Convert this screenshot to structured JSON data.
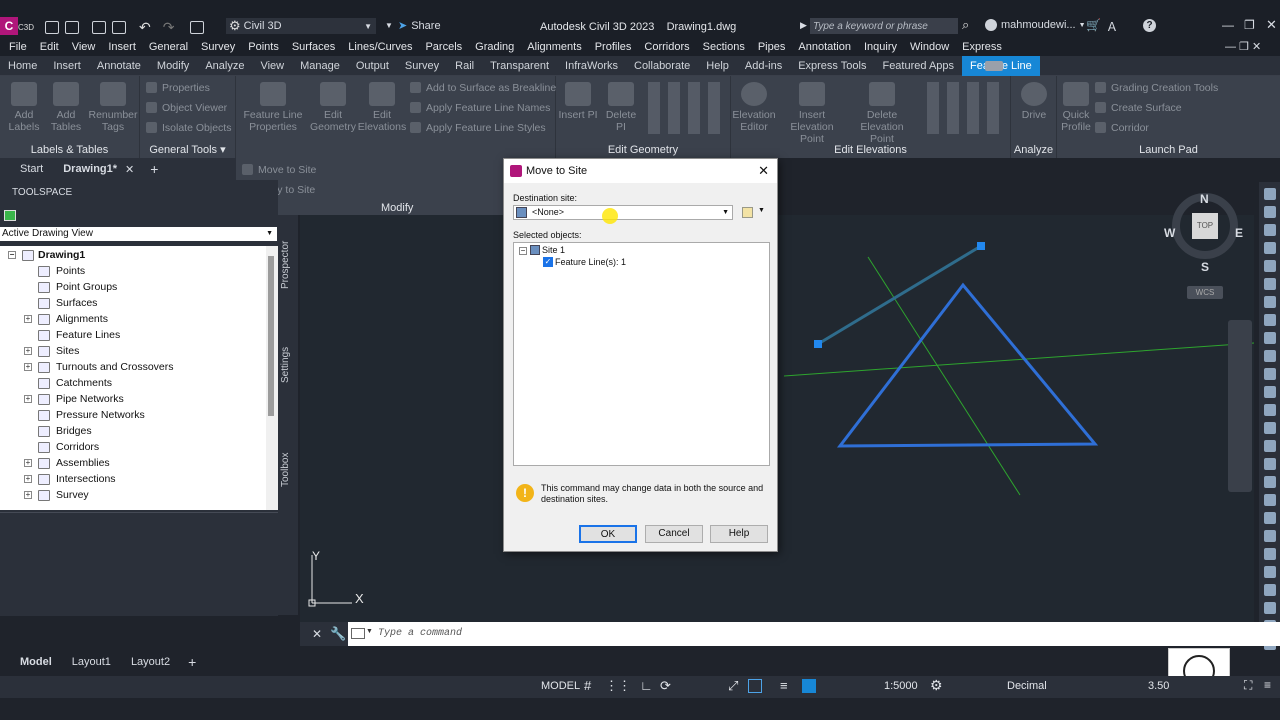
{
  "titlebar": {
    "app_logo": "C",
    "app_sub": "C3D",
    "workspace": "Civil 3D",
    "share": "Share",
    "title": "Autodesk Civil 3D 2023    Drawing1.dwg",
    "search_placeholder": "Type a keyword or phrase",
    "user": "mahmoudewi..."
  },
  "menubar": [
    "File",
    "Edit",
    "View",
    "Insert",
    "General",
    "Survey",
    "Points",
    "Surfaces",
    "Lines/Curves",
    "Parcels",
    "Grading",
    "Alignments",
    "Profiles",
    "Corridors",
    "Sections",
    "Pipes",
    "Annotation",
    "Inquiry",
    "Window",
    "Express"
  ],
  "ribbon_tabs": [
    "Home",
    "Insert",
    "Annotate",
    "Modify",
    "Analyze",
    "View",
    "Manage",
    "Output",
    "Survey",
    "Rail",
    "Transparent",
    "InfraWorks",
    "Collaborate",
    "Help",
    "Add-ins",
    "Express Tools",
    "Featured Apps",
    "Feature Line"
  ],
  "active_tab": "Feature Line",
  "ribbon": {
    "labels_tables": {
      "title": "Labels & Tables",
      "add_labels": "Add Labels",
      "add_tables": "Add Tables",
      "renumber_tags": "Renumber Tags"
    },
    "general_tools": {
      "title": "General Tools",
      "properties": "Properties",
      "object_viewer": "Object Viewer",
      "isolate_objects": "Isolate Objects"
    },
    "modify": {
      "title": "Modify",
      "fl_properties": "Feature Line Properties",
      "edit_geometry": "Edit Geometry",
      "edit_elevations": "Edit Elevations",
      "add_surface": "Add to Surface as Breakline",
      "apply_names": "Apply Feature Line Names",
      "apply_styles": "Apply Feature Line Styles",
      "move_to_site": "Move to Site",
      "copy_to_site": "Copy to Site"
    },
    "edit_geometry": {
      "title": "Edit Geometry",
      "insert_pi": "Insert PI",
      "delete_pi": "Delete PI"
    },
    "edit_elevations": {
      "title": "Edit Elevations",
      "elevation_editor": "Elevation Editor",
      "insert_elev_point": "Insert Elevation Point",
      "delete_elev_point": "Delete Elevation Point"
    },
    "analyze": {
      "title": "Analyze",
      "drive": "Drive"
    },
    "launch_pad": {
      "title": "Launch Pad",
      "quick_profile": "Quick Profile",
      "grading_tools": "Grading Creation Tools",
      "create_surface": "Create Surface",
      "corridor": "Corridor"
    }
  },
  "doc_tabs": {
    "start": "Start",
    "drawing": "Drawing1*"
  },
  "toolspace": {
    "title": "TOOLSPACE",
    "view": "Active Drawing View",
    "root": "Drawing1",
    "items": [
      {
        "label": "Points",
        "exp": ""
      },
      {
        "label": "Point Groups",
        "exp": ""
      },
      {
        "label": "Surfaces",
        "exp": ""
      },
      {
        "label": "Alignments",
        "exp": "+"
      },
      {
        "label": "Feature Lines",
        "exp": ""
      },
      {
        "label": "Sites",
        "exp": "+"
      },
      {
        "label": "Turnouts and Crossovers",
        "exp": "+"
      },
      {
        "label": "Catchments",
        "exp": ""
      },
      {
        "label": "Pipe Networks",
        "exp": "+"
      },
      {
        "label": "Pressure Networks",
        "exp": ""
      },
      {
        "label": "Bridges",
        "exp": ""
      },
      {
        "label": "Corridors",
        "exp": ""
      },
      {
        "label": "Assemblies",
        "exp": "+"
      },
      {
        "label": "Intersections",
        "exp": "+"
      },
      {
        "label": "Survey",
        "exp": "+"
      }
    ],
    "side_tabs": [
      "Prospector",
      "Settings",
      "Toolbox"
    ]
  },
  "dialog": {
    "title": "Move to Site",
    "dest_label": "Destination site:",
    "dest_value": "<None>",
    "sel_label": "Selected objects:",
    "site": "Site 1",
    "feature": "Feature Line(s): 1",
    "warning": "This command may change data in both the source and destination sites.",
    "ok": "OK",
    "cancel": "Cancel",
    "help": "Help"
  },
  "viewcube": {
    "n": "N",
    "s": "S",
    "e": "E",
    "w": "W",
    "top": "TOP",
    "wcs": "WCS"
  },
  "ucs": {
    "x": "X",
    "y": "Y"
  },
  "command": {
    "placeholder": "Type a command"
  },
  "layout_tabs": [
    "Model",
    "Layout1",
    "Layout2"
  ],
  "status": {
    "model": "MODEL",
    "scale": "1:5000",
    "units": "Decimal",
    "elev": "3.50"
  },
  "colors": {
    "accent": "#1787d6",
    "feature_line": "#2f6fd6",
    "green_line": "#2ea52e"
  }
}
